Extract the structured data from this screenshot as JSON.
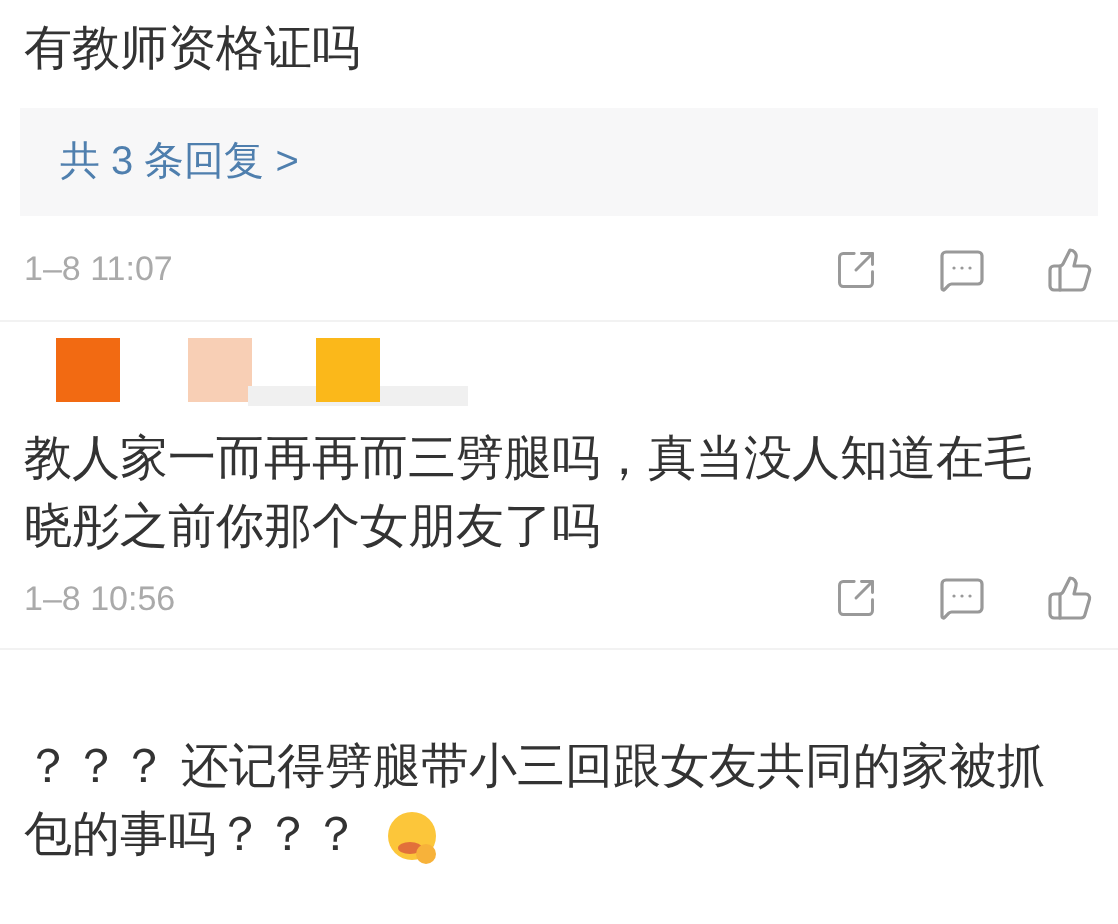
{
  "comments": [
    {
      "kind": "text",
      "lines": [
        "有教师资格证吗"
      ],
      "replies": {
        "label": "共 3 条回复 >"
      },
      "time": "1–8 11:07"
    },
    {
      "kind": "masked",
      "lines": [
        "教人家一而再再而三劈腿吗，真当没人知道在毛",
        "晓彤之前你那个女朋友了吗"
      ],
      "time": "1–8 10:56"
    },
    {
      "kind": "text",
      "lines": [
        "？？？ 还记得劈腿带小三回跟女友共同的家被抓",
        "包的事吗？？？"
      ],
      "emoji": true
    }
  ]
}
